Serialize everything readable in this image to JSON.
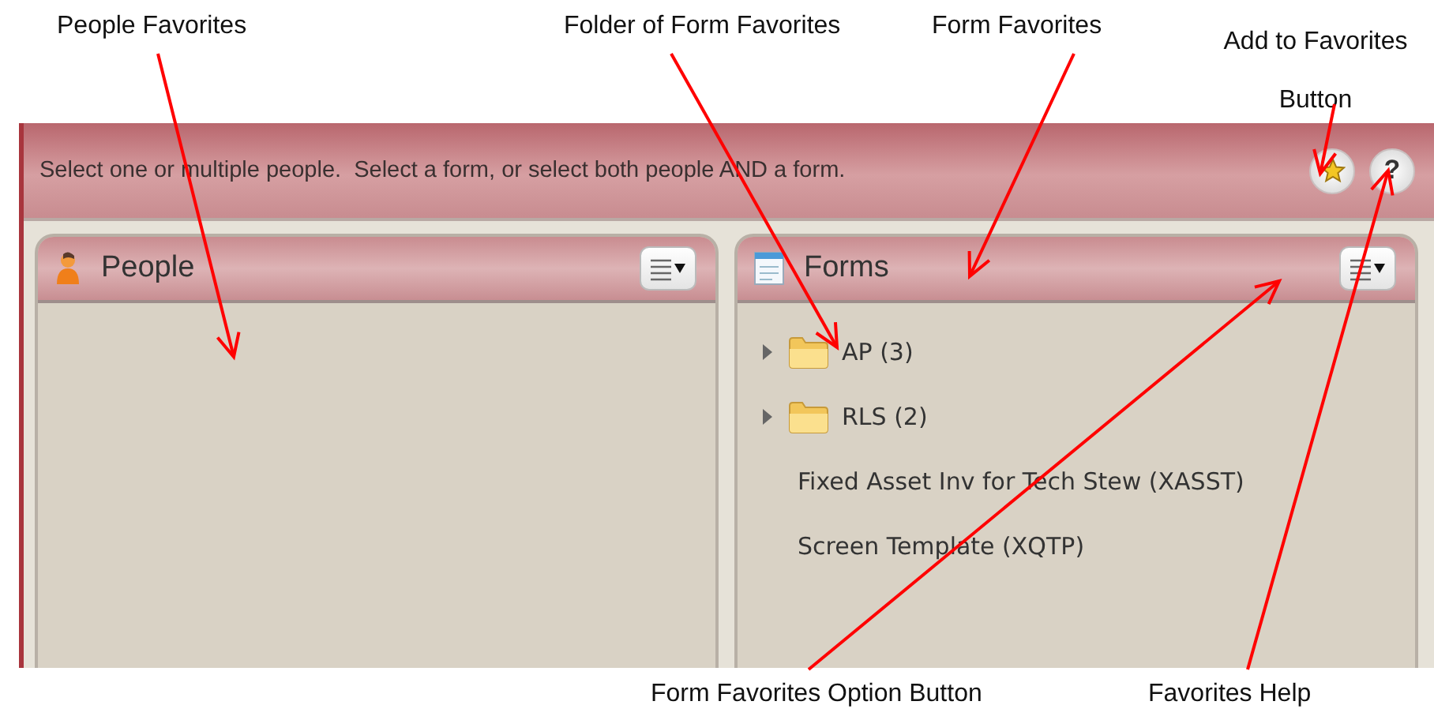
{
  "annotations": [
    {
      "text": "People Favorites"
    },
    {
      "text": "Folder of Form Favorites"
    },
    {
      "text": "Form Favorites"
    },
    {
      "text": "Add to Favorites Button"
    },
    {
      "text": "Form Favorites Option Button"
    },
    {
      "text": "Favorites Help"
    }
  ],
  "toolbar": {
    "instruction": "Select one or multiple people.  Select a form, or select both people AND a form.",
    "buttons": [
      {
        "kind": "favorite"
      },
      {
        "kind": "help",
        "label": "?"
      }
    ]
  },
  "panels": [
    {
      "kind": "people",
      "title": "People"
    },
    {
      "kind": "forms",
      "title": "Forms",
      "items": [
        {
          "kind": "folder",
          "label": "AP (3)",
          "expanded": false
        },
        {
          "kind": "folder",
          "label": "RLS (2)",
          "expanded": false
        },
        {
          "kind": "form",
          "label": "Fixed Asset Inv for Tech Stew (XASST)"
        },
        {
          "kind": "form",
          "label": "Screen Template (XQTP)"
        }
      ]
    }
  ]
}
